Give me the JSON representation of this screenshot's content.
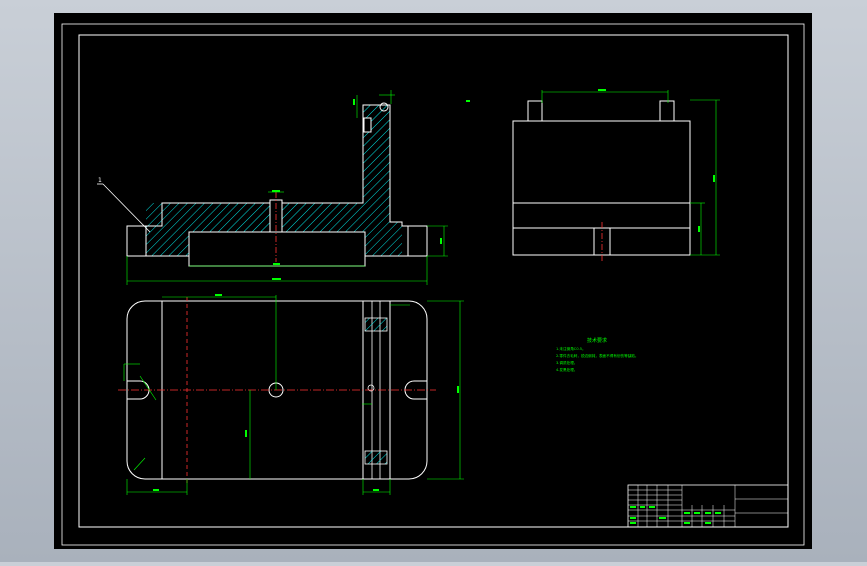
{
  "colors": {
    "background": "#000000",
    "outline": "#ffffff",
    "dimension": "#00ff00",
    "centerline": "#ff3333",
    "hatch": "#00ffff",
    "notes": "#00ff00"
  },
  "drawing": {
    "leader_tag": "1",
    "notes_title": "技术要求",
    "notes": [
      "1.未注倒角C0.5。",
      "2.零件去毛刺，锐边倒钝，表面不得有划伤等缺陷。",
      "3.调质处理。",
      "4.发黑处理。"
    ]
  },
  "icons": {
    "background_panel": "viewport-gradient"
  }
}
